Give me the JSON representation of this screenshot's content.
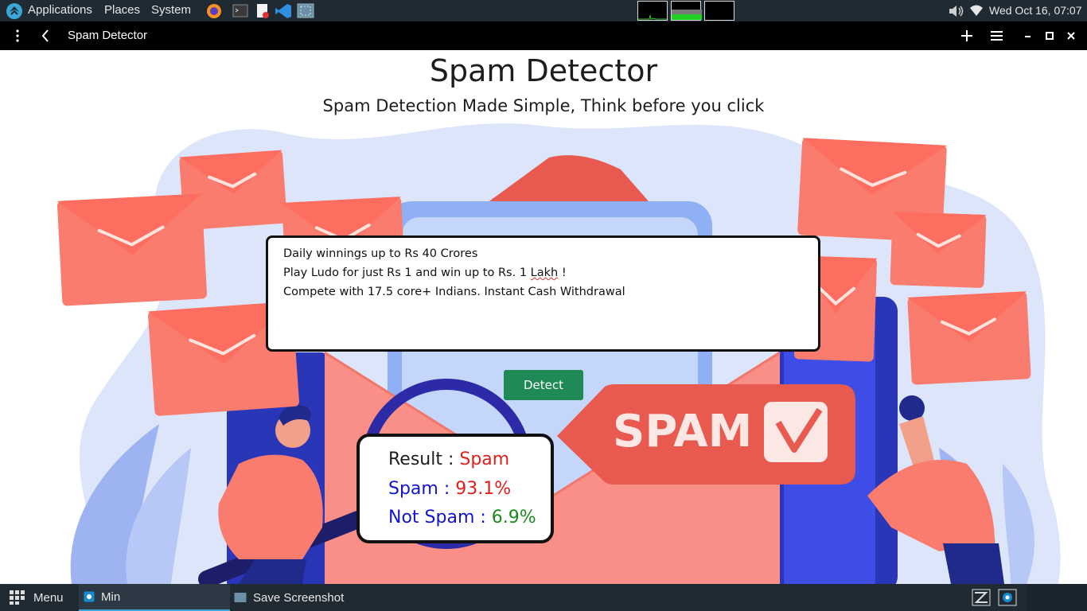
{
  "system_panel": {
    "menus": [
      "Applications",
      "Places",
      "System"
    ],
    "launchers": [
      "firefox-icon",
      "terminal-icon",
      "text-editor-icon",
      "vscode-icon",
      "screenshot-tool-icon"
    ],
    "clock": "Wed Oct 16, 07:07"
  },
  "app_bar": {
    "title": "Spam Detector"
  },
  "page": {
    "title": "Spam Detector",
    "subtitle": "Spam Detection Made Simple, Think before you click",
    "message_lines": [
      "Daily winnings up to Rs 40 Crores",
      "Play Ludo for just Rs 1 and win up to Rs. 1 ",
      "Lakh",
      " !",
      "Compete with 17.5 core+ Indians. Instant Cash Withdrawal"
    ],
    "detect_label": "Detect",
    "result": {
      "result_label": "Result : ",
      "result_value": "Spam",
      "spam_label": "Spam : ",
      "spam_value": "93.1%",
      "not_spam_label": "Not Spam : ",
      "not_spam_value": "6.9%"
    },
    "illustration_tag": "SPAM"
  },
  "taskbar": {
    "menu_label": "Menu",
    "tasks": [
      "Min",
      "Save Screenshot"
    ]
  },
  "colors": {
    "panel": "#1f2a33",
    "accent_green": "#1f8a55",
    "spam_red": "#e0201c",
    "label_blue": "#1414c8",
    "ok_green": "#1a8a1a",
    "envelope": "#fa7c6e"
  }
}
